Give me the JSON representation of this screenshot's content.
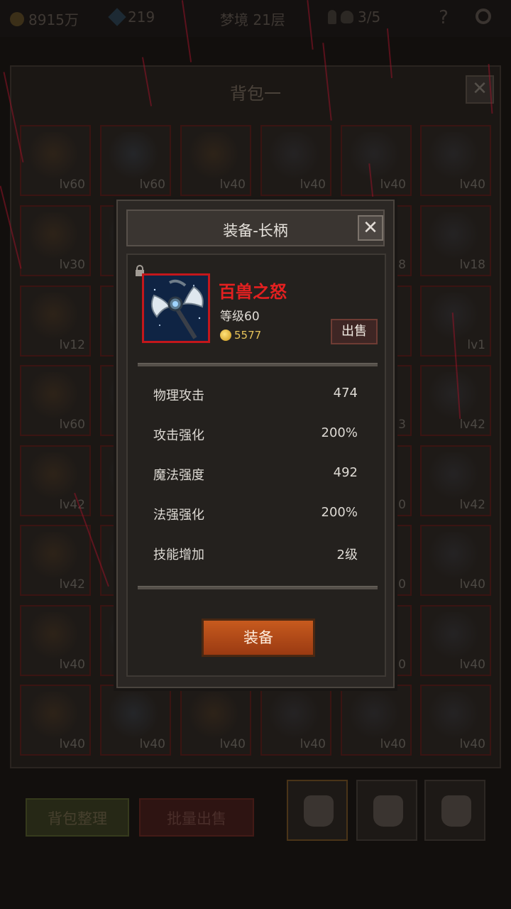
{
  "topbar": {
    "coins": "8915万",
    "gems": "219",
    "dream_floor": "梦境 21层",
    "keys": "3/5",
    "help_icon": "?"
  },
  "bag": {
    "title": "背包一",
    "close_label": "✕",
    "sort_label": "背包整理",
    "bulk_sell_label": "批量出售",
    "grid": [
      [
        "lv60",
        "lv60",
        "lv40",
        "lv40",
        "lv40",
        "lv40"
      ],
      [
        "lv30",
        "",
        "",
        "",
        "8",
        "lv18"
      ],
      [
        "lv12",
        "",
        "",
        "",
        "",
        "lv1"
      ],
      [
        "lv60",
        "",
        "",
        "",
        "3",
        "lv42"
      ],
      [
        "lv42",
        "",
        "",
        "",
        "0",
        "lv42"
      ],
      [
        "lv42",
        "",
        "",
        "",
        "0",
        "lv40"
      ],
      [
        "lv40",
        "",
        "",
        "",
        "0",
        "lv40"
      ],
      [
        "lv40",
        "lv40",
        "lv40",
        "lv40",
        "lv40",
        "lv40"
      ]
    ]
  },
  "popup": {
    "title": "装备-长柄",
    "close_label": "✕",
    "lock_icon": "lock-icon",
    "item_name": "百兽之怒",
    "item_level": "等级60",
    "item_price": "5577",
    "sell_label": "出售",
    "stats": [
      {
        "label": "物理攻击",
        "value": "474"
      },
      {
        "label": "攻击强化",
        "value": "200%"
      },
      {
        "label": "魔法强度",
        "value": "492"
      },
      {
        "label": "法强强化",
        "value": "200%"
      },
      {
        "label": "技能增加",
        "value": "2级"
      }
    ],
    "equip_label": "装备"
  },
  "colors": {
    "item_name": "#e42020",
    "price": "#e6c35a",
    "equip_button": "#c75a1e",
    "rarity_border": "#c3171b"
  }
}
